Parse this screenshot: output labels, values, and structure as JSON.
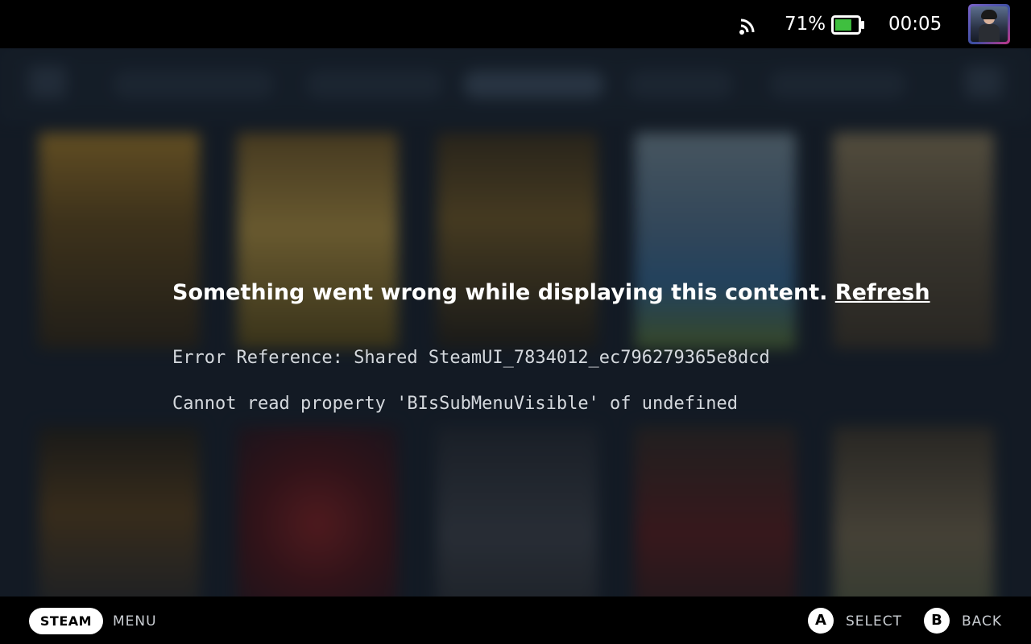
{
  "status_bar": {
    "wifi_icon": "wifi-icon",
    "battery_percent": "71%",
    "battery_icon": "battery-icon",
    "battery_level": 0.71,
    "battery_color": "#3fbf3f",
    "clock": "00:05",
    "avatar": "user-avatar"
  },
  "error": {
    "message": "Something went wrong while displaying this content.",
    "refresh_label": "Refresh",
    "reference": "Error Reference: Shared SteamUI_7834012_ec796279365e8dcd",
    "detail": "Cannot read property 'BIsSubMenuVisible' of undefined"
  },
  "bottom_bar": {
    "steam_button": "STEAM",
    "menu_label": "MENU",
    "a_glyph": "A",
    "select_label": "SELECT",
    "b_glyph": "B",
    "back_label": "BACK"
  },
  "colors": {
    "background": "#1b2532",
    "bar": "#000000",
    "text": "#ffffff"
  }
}
